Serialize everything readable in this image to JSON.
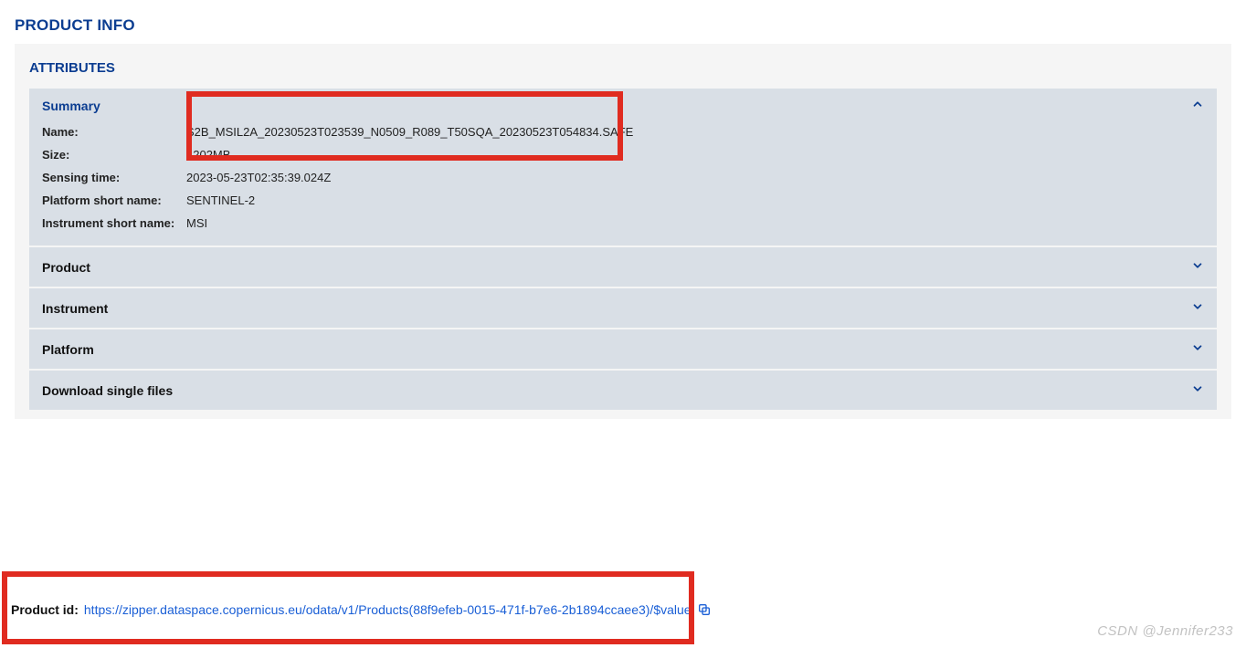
{
  "page": {
    "title": "PRODUCT INFO"
  },
  "attributes": {
    "title": "ATTRIBUTES",
    "summary": {
      "header": "Summary",
      "rows": [
        {
          "label": "Name:",
          "value": "S2B_MSIL2A_20230523T023539_N0509_R089_T50SQA_20230523T054834.SAFE"
        },
        {
          "label": "Size:",
          "value": "1202MB"
        },
        {
          "label": "Sensing time:",
          "value": "2023-05-23T02:35:39.024Z"
        },
        {
          "label": "Platform short name:",
          "value": "SENTINEL-2"
        },
        {
          "label": "Instrument short name:",
          "value": "MSI"
        }
      ]
    },
    "sections": [
      {
        "label": "Product"
      },
      {
        "label": "Instrument"
      },
      {
        "label": "Platform"
      },
      {
        "label": "Download single files"
      }
    ]
  },
  "product_id": {
    "label": "Product id:",
    "url": "https://zipper.dataspace.copernicus.eu/odata/v1/Products(88f9efeb-0015-471f-b7e6-2b1894ccaee3)/$value"
  },
  "watermark": "CSDN @Jennifer233",
  "highlight_colors": {
    "box": "#e02b20"
  }
}
